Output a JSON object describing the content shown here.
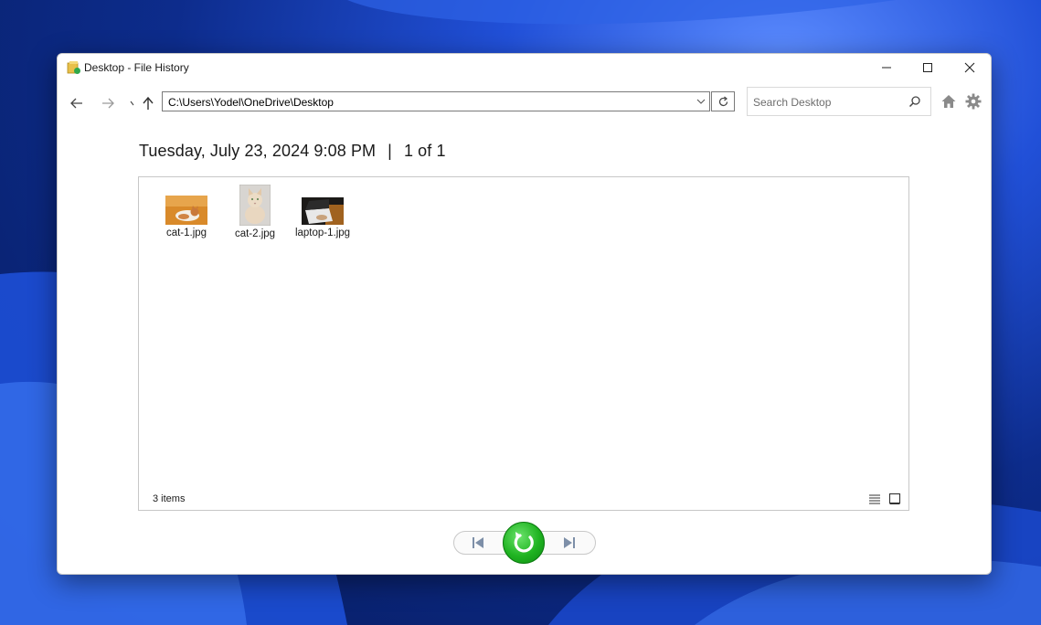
{
  "window": {
    "title": "Desktop - File History",
    "controls": {
      "minimize_icon": "minimize-icon",
      "maximize_icon": "maximize-icon",
      "close_icon": "close-icon"
    }
  },
  "toolbar": {
    "address": "C:\\Users\\Yodel\\OneDrive\\Desktop",
    "search_placeholder": "Search Desktop"
  },
  "header": {
    "timestamp": "Tuesday, July 23, 2024 9:08 PM",
    "separator": "|",
    "position": "1 of 1"
  },
  "files": [
    {
      "name": "cat-1.jpg",
      "icon": "cat-photo-thumbnail"
    },
    {
      "name": "cat-2.jpg",
      "icon": "cat-photo-thumbnail"
    },
    {
      "name": "laptop-1.jpg",
      "icon": "laptop-photo-thumbnail"
    }
  ],
  "status": {
    "item_count": "3 items"
  },
  "colors": {
    "restore_green": "#1fb321",
    "window_bg": "#ffffff"
  }
}
